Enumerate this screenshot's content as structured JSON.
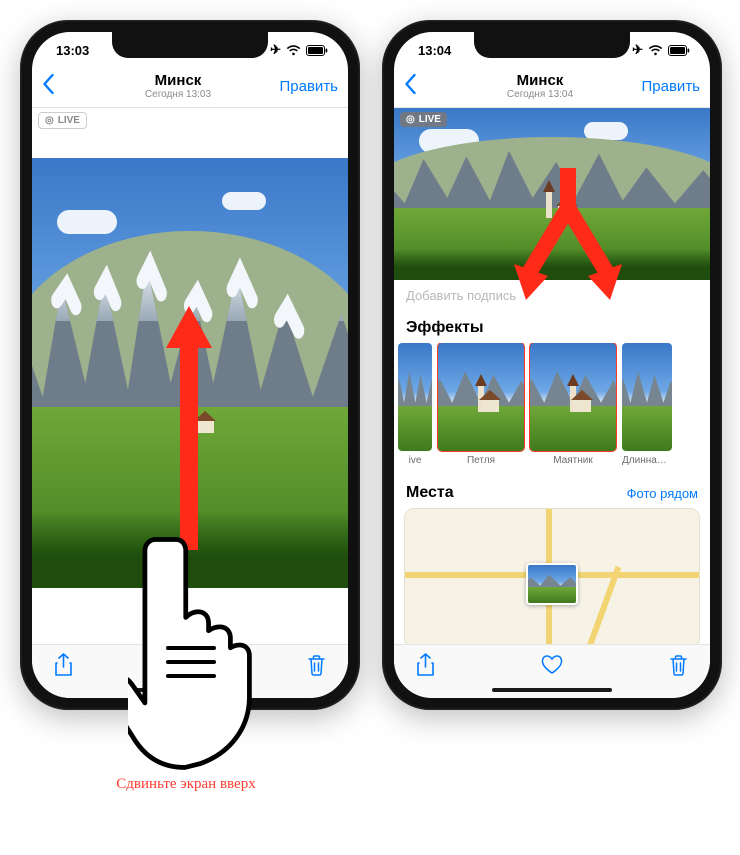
{
  "left": {
    "status_time": "13:03",
    "title": "Минск",
    "subtitle": "Сегодня 13:03",
    "edit": "Править",
    "live_badge": "LIVE"
  },
  "right": {
    "status_time": "13:04",
    "title": "Минск",
    "subtitle": "Сегодня 13:04",
    "edit": "Править",
    "live_badge": "LIVE",
    "caption_placeholder": "Добавить подпись",
    "effects_title": "Эффекты",
    "effects": [
      {
        "label": "ive",
        "highlighted": false
      },
      {
        "label": "Петля",
        "highlighted": true
      },
      {
        "label": "Маятник",
        "highlighted": true
      },
      {
        "label": "Длинная выде",
        "highlighted": false
      }
    ],
    "places_title": "Места",
    "places_link": "Фото рядом"
  },
  "overlay": {
    "swipe_caption": "Сдвиньте экран вверх",
    "arrow_color": "#ff2a18"
  },
  "icons": {
    "back": "‹",
    "target": "◎"
  }
}
